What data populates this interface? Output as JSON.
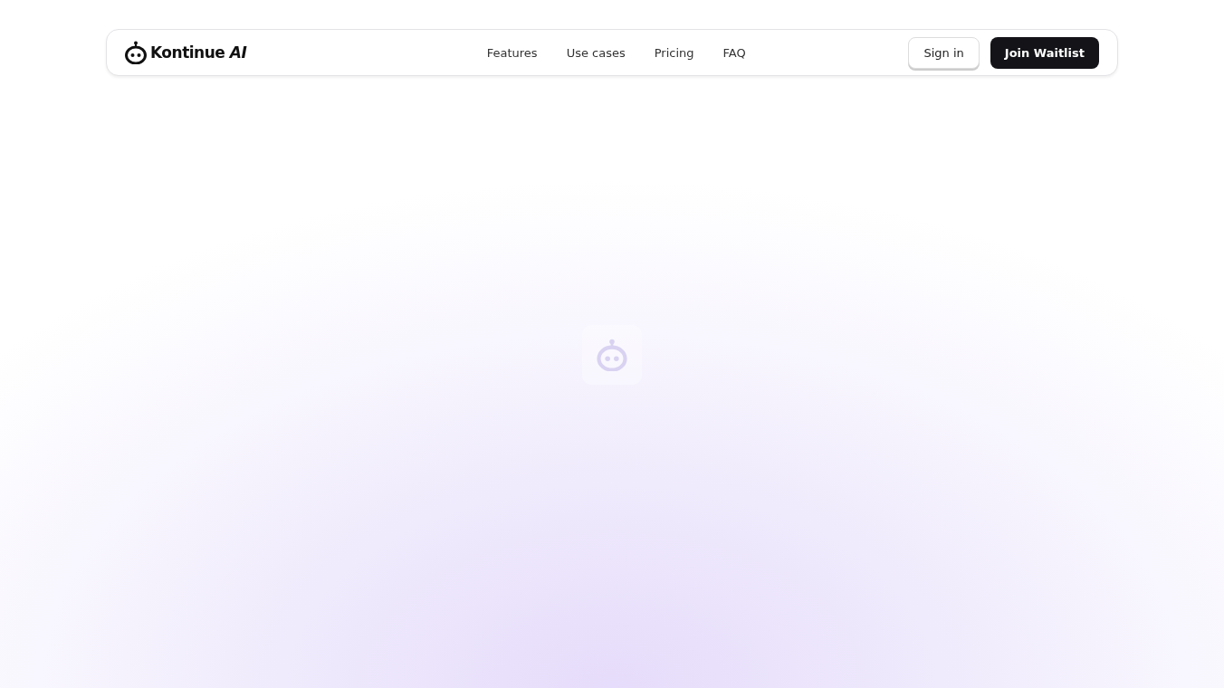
{
  "header": {
    "logo": "Kontinue *AI*",
    "nav": [
      "Features",
      "Use cases",
      "Pricing",
      "FAQ"
    ],
    "sign_in": "Sign in",
    "join": "Join Waitlist"
  }
}
